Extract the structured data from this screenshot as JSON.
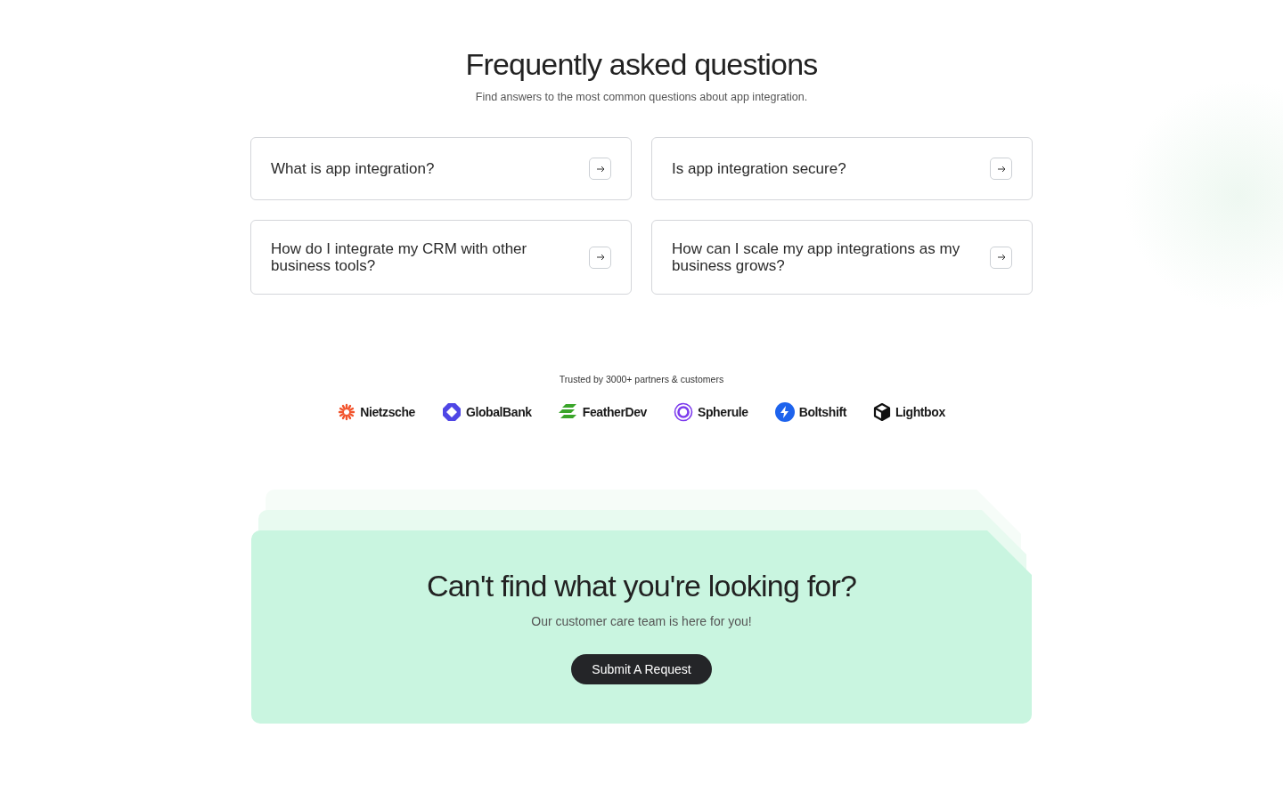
{
  "header": {
    "title": "Frequently asked questions",
    "subtitle": "Find answers to the most common questions about app integration."
  },
  "faqs": [
    {
      "question": "What is app integration?"
    },
    {
      "question": "Is app integration secure?"
    },
    {
      "question": "How do I integrate my CRM with other business tools?"
    },
    {
      "question": "How can I scale my app integrations as my business grows?"
    }
  ],
  "trusted": {
    "caption": "Trusted by 3000+ partners & customers",
    "logos": [
      {
        "name": "Nietzsche",
        "kind": "burst"
      },
      {
        "name": "GlobalBank",
        "kind": "octagon"
      },
      {
        "name": "FeatherDev",
        "kind": "feather"
      },
      {
        "name": "Spherule",
        "kind": "sphere"
      },
      {
        "name": "Boltshift",
        "kind": "bolt"
      },
      {
        "name": "Lightbox",
        "kind": "cube"
      }
    ]
  },
  "cta": {
    "title": "Can't find what you're looking for?",
    "subtitle": "Our customer care team is here for you!",
    "button": "Submit A Request"
  }
}
